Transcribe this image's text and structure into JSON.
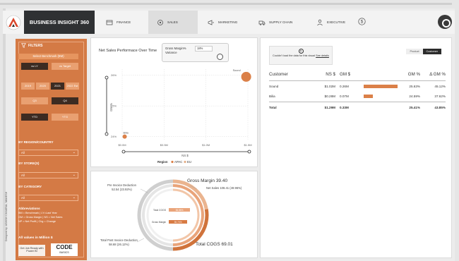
{
  "header": {
    "brand": "BUSINESS INSIGHT 360",
    "nav": [
      {
        "label": "FINANCE",
        "icon": "finance-icon"
      },
      {
        "label": "SALES",
        "icon": "sales-icon",
        "active": true
      },
      {
        "label": "MARKETING",
        "icon": "marketing-icon"
      },
      {
        "label": "SUPPLY CHAIN",
        "icon": "supply-chain-icon"
      },
      {
        "label": "EXECUTIVE",
        "icon": "executive-icon"
      }
    ]
  },
  "filters": {
    "title": "FILTERS",
    "benchmark_label": "Select Benchmark (BM)",
    "benchmark_options": [
      "vs LY",
      "vs Target"
    ],
    "years": [
      "2019",
      "2020",
      "2021",
      "2022 Est"
    ],
    "quarters": [
      "Q3",
      "Q4"
    ],
    "periods": [
      "YTD",
      "YTG"
    ],
    "region_label": "BY REGION/COUNTRY",
    "region_value": "All",
    "stores_label": "BY STORE(S)",
    "stores_value": "All",
    "category_label": "BY CATEGORY",
    "category_value": "All",
    "abbreviations_title": "Abbreviations",
    "abbreviations": [
      "BM = Benchmark | LY=Last Year",
      "GM = Gross Margin | NS = Net Sales",
      "NP = Net Profit | Chg = Change"
    ],
    "all_values": "All values in Million $",
    "get_job": "Get Job Ready with Power BI",
    "codebasics": "CODE",
    "codebasics_sub": "BASICS",
    "designer": "Designed by: ASHISH CHAKRAL, MAKESH"
  },
  "scatter": {
    "title": "Net Sales Performace Over Time",
    "gm_filter_label": "Gross Margin% Variance",
    "gm_filter_value": "18%",
    "chart_data": {
      "type": "scatter",
      "xlabel": "NS $",
      "ylabel": "GM %",
      "x_ticks": [
        "$0.0M",
        "$0.5M",
        "$1.0M",
        "$1.5M"
      ],
      "y_ticks": [
        "24%",
        "25%",
        "26%"
      ],
      "xlim": [
        0.0,
        1.5
      ],
      "ylim": [
        23.9,
        26.2
      ],
      "legend_title": "Region",
      "legend": [
        {
          "name": "APAC",
          "color": "#db8048"
        },
        {
          "name": "EU",
          "color": "#e6b08a"
        }
      ],
      "points": [
        {
          "label": "Bilia",
          "x": 0.03,
          "y": 24.0,
          "size": 3
        },
        {
          "label": "Sound",
          "x": 1.48,
          "y": 25.95,
          "size": 7
        }
      ]
    }
  },
  "donut": {
    "chart_data": {
      "type": "pie",
      "rings": [
        {
          "name": "Gross Margin",
          "value": 39.4
        },
        {
          "name": "Total COGS",
          "value": 69.01
        }
      ]
    },
    "gross_margin_title": "Gross Margin 39.40",
    "net_sales_label": "Net Sales 108.41 (49.96%)",
    "pre_invoice_label": "Pre Invoice Deduction",
    "pre_invoice_value": "52.54 (23.92%)",
    "post_invoice_label": "Total Post Invoice Deduction",
    "post_invoice_value": "58.68 (26.12%)",
    "total_cogs_title": "Total COGS 69.01",
    "inner_labels": [
      {
        "label": "Total COGS",
        "value": "36.86%"
      },
      {
        "label": "Gross Margin",
        "value": "35.74%"
      }
    ]
  },
  "table": {
    "info_text": "Couldn't load the data for this visual",
    "info_link": "See details",
    "toggle": [
      "Product",
      "Customer"
    ],
    "headers": [
      "Customer",
      "NS $",
      "GM $",
      "GM %",
      "Δ GM %"
    ],
    "rows": [
      {
        "customer": "Sound",
        "ns": "$1.02M",
        "gm": "0.26M",
        "gm_pct": "25.63%",
        "delta": "45.12%",
        "bar": 0.95
      },
      {
        "customer": "Bilia",
        "ns": "$0.28M",
        "gm": "0.07M",
        "gm_pct": "24.59%",
        "delta": "37.62%",
        "bar": 0.26
      }
    ],
    "total": {
      "customer": "Total",
      "ns": "$1.29M",
      "gm": "0.33M",
      "gm_pct": "25.41%",
      "delta": "43.85%"
    }
  }
}
